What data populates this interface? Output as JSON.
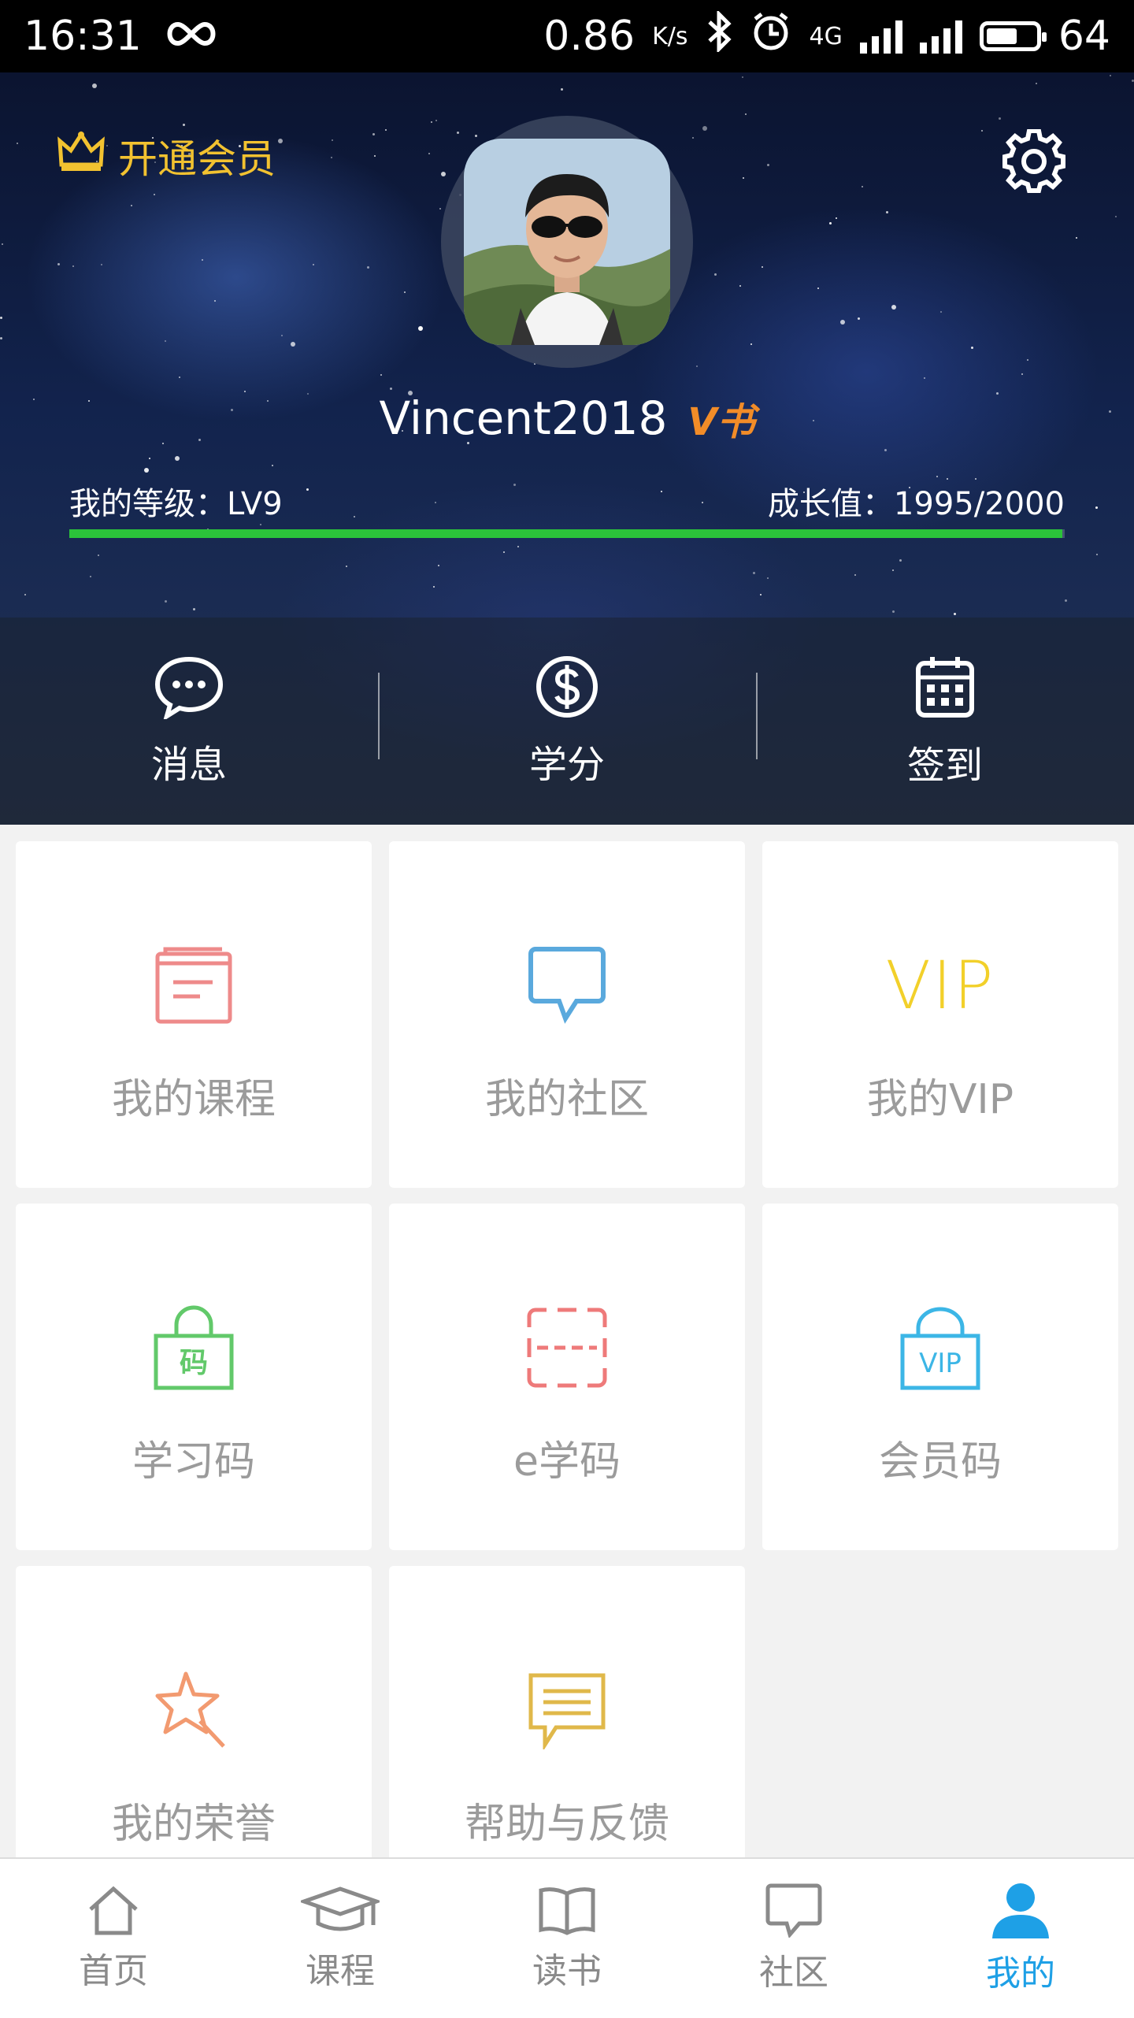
{
  "status_bar": {
    "time": "16:31",
    "net_speed": "0.86",
    "net_unit": "K/s",
    "network": "4G",
    "battery": "64",
    "battery_level": 0.64,
    "icons": [
      "infinity-icon",
      "bluetooth-icon",
      "alarm-icon",
      "signal-icon",
      "battery-icon"
    ]
  },
  "header": {
    "open_vip_label": "开通会员",
    "username": "Vincent2018",
    "badge": "V书",
    "level_text": "我的等级：LV9",
    "growth_text": "成长值：1995/2000",
    "growth_progress": 0.9975,
    "progress_color": "#2bc33a"
  },
  "quick_actions": [
    {
      "label": "消息",
      "icon": "chat-bubble-icon"
    },
    {
      "label": "学分",
      "icon": "dollar-circle-icon"
    },
    {
      "label": "签到",
      "icon": "calendar-icon"
    }
  ],
  "grid_items": [
    {
      "label": "我的课程",
      "icon": "book-icon",
      "color": "#ee8a8a"
    },
    {
      "label": "我的社区",
      "icon": "speech-bubble-icon",
      "color": "#5aa9dd"
    },
    {
      "label": "我的VIP",
      "icon": "vip-text-icon",
      "color": "#f2d02a",
      "icon_text": "VIP"
    },
    {
      "label": "学习码",
      "icon": "code-bag-icon",
      "color": "#62c96a",
      "icon_text": "码"
    },
    {
      "label": "e学码",
      "icon": "scan-icon",
      "color": "#ee7a7a"
    },
    {
      "label": "会员码",
      "icon": "vip-bag-icon",
      "color": "#3cb6e6",
      "icon_text": "VIP"
    },
    {
      "label": "我的荣誉",
      "icon": "star-icon",
      "color": "#f29a70"
    },
    {
      "label": "帮助与反馈",
      "icon": "feedback-icon",
      "color": "#e0b84a"
    }
  ],
  "bottom_nav": [
    {
      "label": "首页",
      "icon": "home-icon"
    },
    {
      "label": "课程",
      "icon": "graduation-cap-icon"
    },
    {
      "label": "读书",
      "icon": "open-book-icon"
    },
    {
      "label": "社区",
      "icon": "chat-icon"
    },
    {
      "label": "我的",
      "icon": "user-icon",
      "active": true
    }
  ],
  "colors": {
    "accent": "#1ea0e6",
    "vip_gold": "#f2c230"
  }
}
